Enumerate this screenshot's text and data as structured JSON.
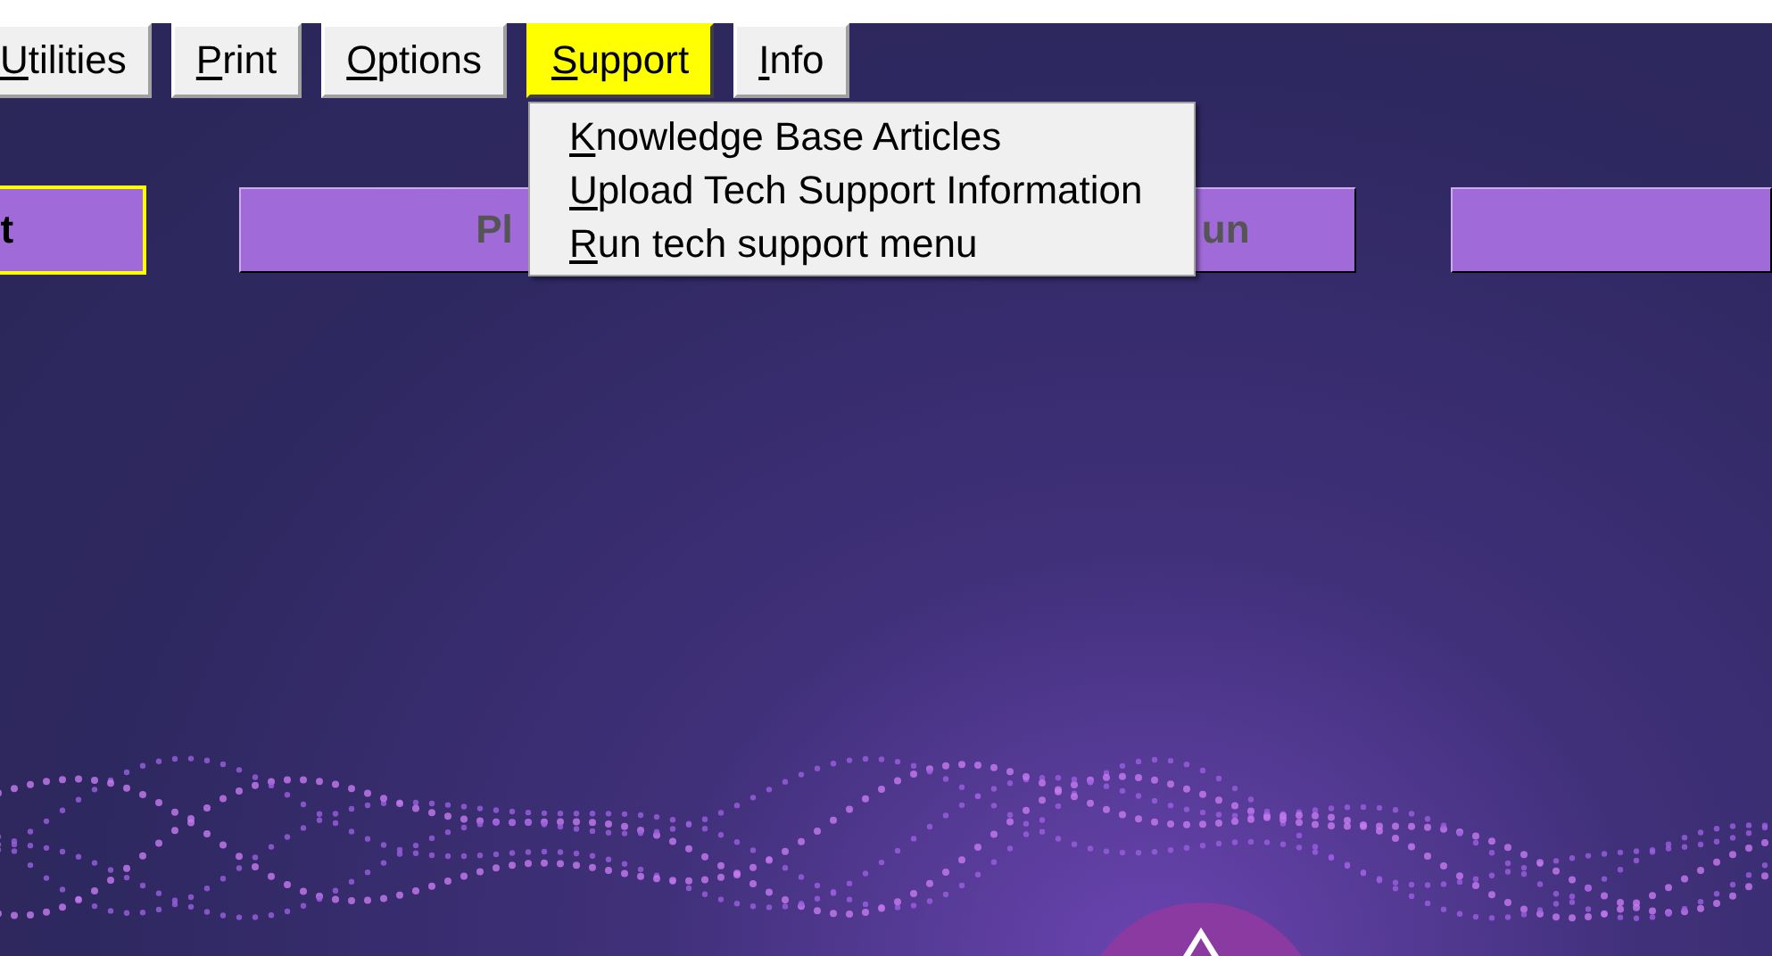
{
  "menu_bar": [
    {
      "label": "Utilities",
      "selected": false
    },
    {
      "label": "Print",
      "selected": false
    },
    {
      "label": "Options",
      "selected": false
    },
    {
      "label": "Support",
      "selected": true
    },
    {
      "label": "Info",
      "selected": false
    }
  ],
  "dropdown": {
    "items": [
      {
        "label": "Knowledge Base Articles"
      },
      {
        "label": "Upload Tech Support Information"
      },
      {
        "label": "Run tech support menu"
      }
    ]
  },
  "buttons": [
    {
      "label_parts": [
        "t"
      ],
      "focused": true,
      "disabled": false
    },
    {
      "label_parts": [
        "Pl",
        "un"
      ],
      "focused": false,
      "disabled": true
    },
    {
      "focused": false
    }
  ]
}
